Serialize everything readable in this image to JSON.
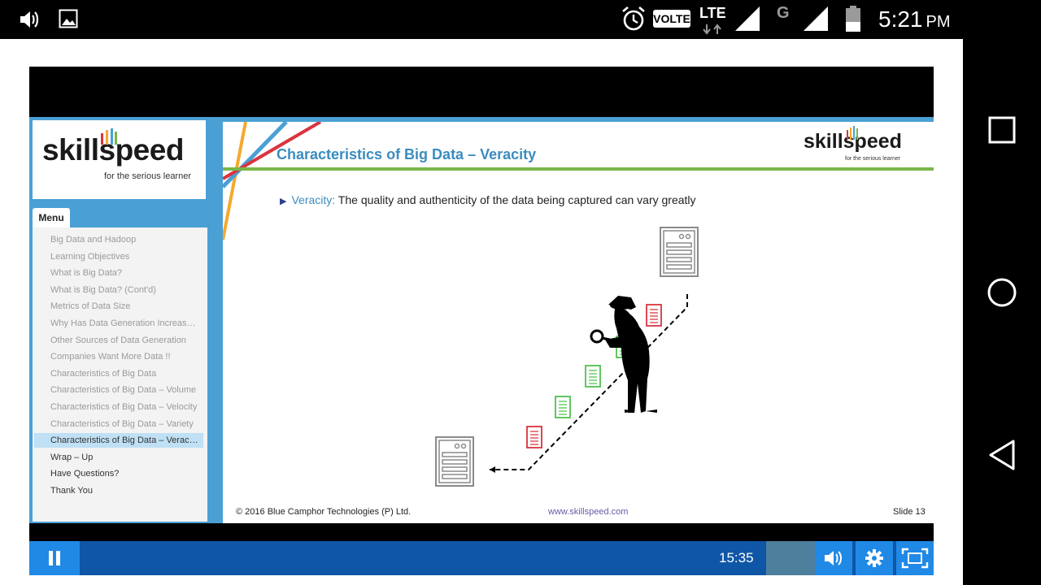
{
  "status_bar": {
    "volte_label": "VOLTE",
    "network_label": "LTE",
    "secondary_network": "G",
    "time": "5:21",
    "ampm": "PM",
    "left_icons": [
      "volume-icon",
      "image-icon"
    ],
    "right_icons": [
      "alarm-icon",
      "signal-icon",
      "battery-icon"
    ]
  },
  "course": {
    "logo_text": "skillspeed",
    "logo_tagline": "for the serious learner",
    "menu_tab": "Menu",
    "menu_items": [
      {
        "label": "Big Data and Hadoop",
        "state": "visited"
      },
      {
        "label": "Learning Objectives",
        "state": "visited"
      },
      {
        "label": "What is Big Data?",
        "state": "visited"
      },
      {
        "label": "What is Big Data? (Cont'd)",
        "state": "visited"
      },
      {
        "label": "Metrics of Data Size",
        "state": "visited"
      },
      {
        "label": "Why Has Data Generation Increas…",
        "state": "visited"
      },
      {
        "label": "Other Sources of Data Generation",
        "state": "visited"
      },
      {
        "label": "Companies Want More Data !!",
        "state": "visited"
      },
      {
        "label": "Characteristics of Big Data",
        "state": "visited"
      },
      {
        "label": "Characteristics of Big Data – Volume",
        "state": "visited"
      },
      {
        "label": "Characteristics of Big Data – Velocity",
        "state": "visited"
      },
      {
        "label": "Characteristics of Big Data – Variety",
        "state": "visited"
      },
      {
        "label": "Characteristics of Big Data – Verac…",
        "state": "active"
      },
      {
        "label": "Wrap – Up",
        "state": "normal"
      },
      {
        "label": "Have Questions?",
        "state": "normal"
      },
      {
        "label": "Thank You",
        "state": "normal"
      }
    ]
  },
  "slide": {
    "title": "Characteristics of Big Data – Veracity",
    "logo_text": "skillspeed",
    "logo_tagline": "for the serious learner",
    "bullet_term": "Veracity:",
    "bullet_text": " The quality and authenticity of the data being captured can vary greatly",
    "footer_copyright": "© 2016 Blue Camphor Technologies (P) Ltd.",
    "footer_url": "www.skillspeed.com",
    "slide_number": "Slide 13",
    "colors": {
      "title": "#3a8cc0",
      "rule": "#7ab648",
      "doc_red": "#d9343f",
      "doc_green": "#4ec24e"
    }
  },
  "player": {
    "time": "15:35",
    "controls": [
      "pause-icon",
      "volume-icon",
      "settings-icon",
      "fullscreen-icon"
    ],
    "accent": "#2089e6",
    "bar_color": "#0f56a6"
  },
  "nav_bar": {
    "buttons": [
      "recents-icon",
      "home-icon",
      "back-icon"
    ]
  }
}
